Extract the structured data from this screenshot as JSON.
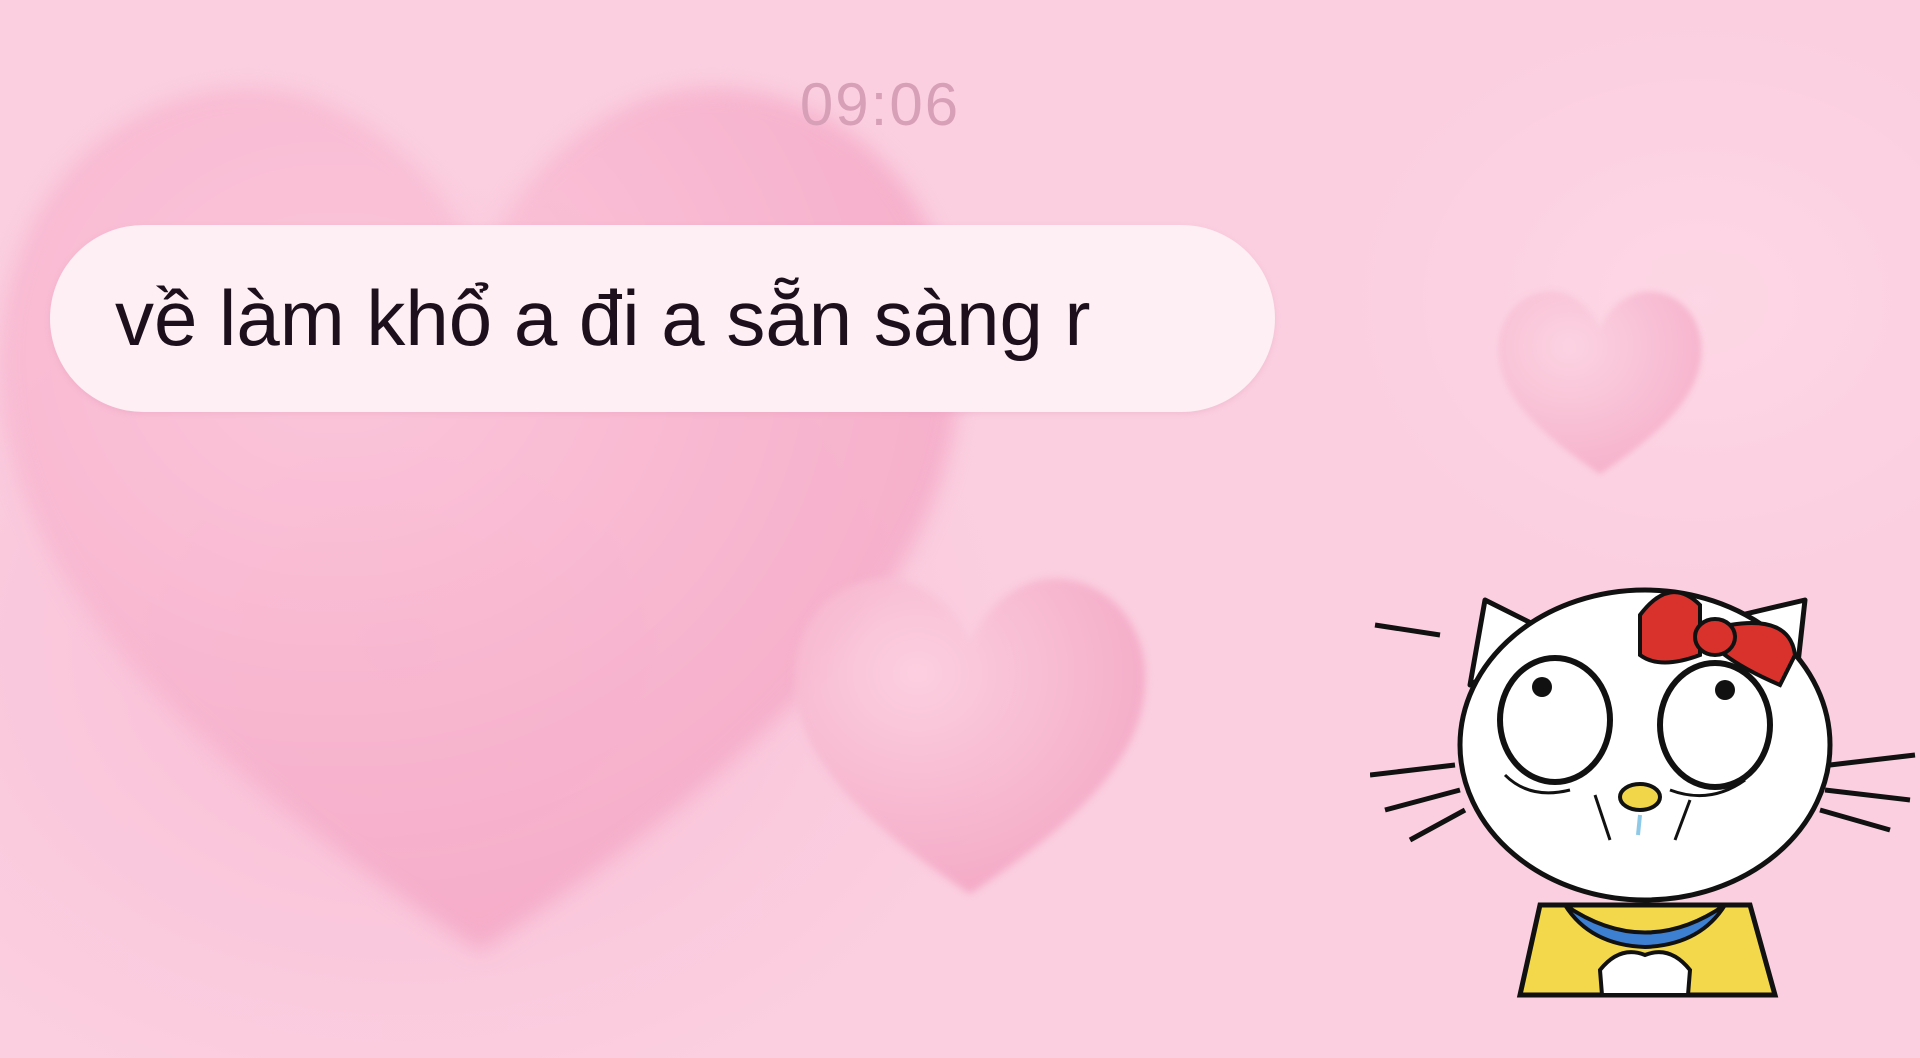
{
  "chat": {
    "timestamp": "09:06",
    "message": "về làm khổ a đi a sẵn sàng r"
  },
  "sticker": {
    "icon": "hello-kitty-crying-sticker"
  },
  "colors": {
    "background": "#fbcfe0",
    "heart": "#f7afcb",
    "bubble": "#fdeff3",
    "message_text": "#1d0f1c",
    "timestamp_text": "#d7a0b7",
    "bow": "#d9322d",
    "shirt": "#f2d84a",
    "collar": "#3d7fd1",
    "nose": "#f2d64a"
  }
}
